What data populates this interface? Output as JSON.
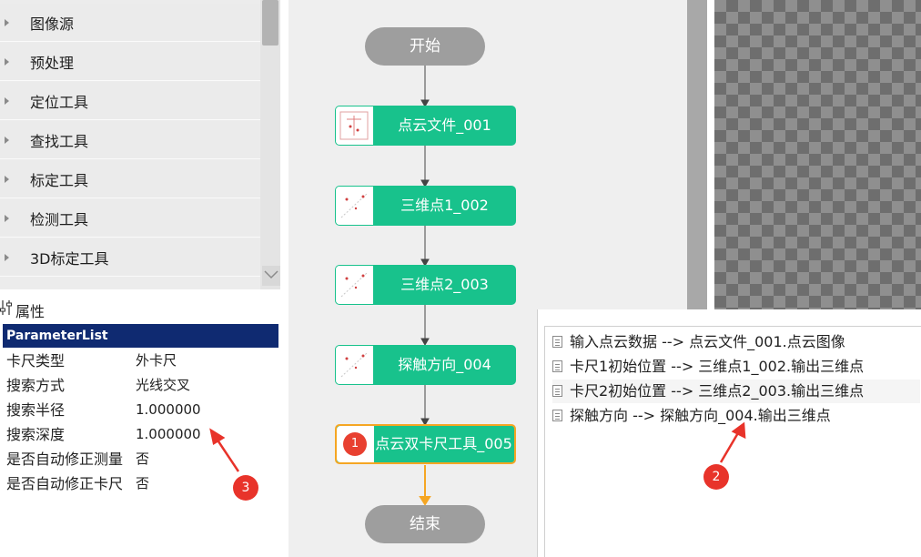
{
  "tree": {
    "items": [
      {
        "label": "图像源"
      },
      {
        "label": "预处理"
      },
      {
        "label": "定位工具"
      },
      {
        "label": "查找工具"
      },
      {
        "label": "标定工具"
      },
      {
        "label": "检测工具"
      },
      {
        "label": "3D标定工具"
      }
    ]
  },
  "props": {
    "title": "属性",
    "list_title": "ParameterList",
    "rows": [
      {
        "key": "卡尺类型",
        "value": "外卡尺"
      },
      {
        "key": "搜索方式",
        "value": "光线交叉"
      },
      {
        "key": "搜索半径",
        "value": "1.000000"
      },
      {
        "key": "搜索深度",
        "value": "1.000000"
      },
      {
        "key": "是否自动修正测量",
        "value": "否"
      },
      {
        "key": "是否自动修正卡尺",
        "value": "否"
      }
    ]
  },
  "flow": {
    "start_label": "开始",
    "end_label": "结束",
    "nodes": [
      {
        "label": "点云文件_001"
      },
      {
        "label": "三维点1_002"
      },
      {
        "label": "三维点2_003"
      },
      {
        "label": "探触方向_004"
      },
      {
        "label": "点云双卡尺工具_005",
        "marker": "1"
      }
    ]
  },
  "links": {
    "rows": [
      {
        "text": "输入点云数据  -->  点云文件_001.点云图像"
      },
      {
        "text": "卡尺1初始位置  -->  三维点1_002.输出三维点"
      },
      {
        "text": "卡尺2初始位置  -->  三维点2_003.输出三维点"
      },
      {
        "text": "探触方向  -->  探触方向_004.输出三维点"
      }
    ]
  },
  "annotations": {
    "marker_2": "2",
    "marker_3": "3"
  },
  "colors": {
    "node_green": "#18c28c",
    "selected_border": "#f5a623",
    "header_navy": "#0f2a71",
    "marker_red": "#e8332a"
  }
}
